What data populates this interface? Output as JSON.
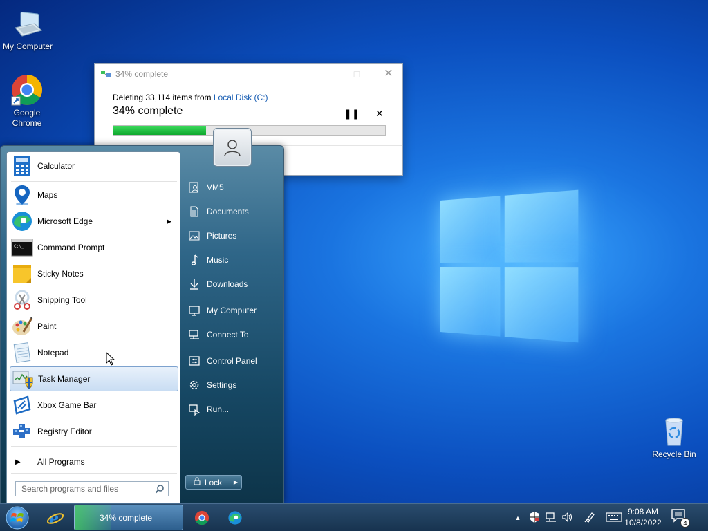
{
  "desktop": {
    "icons": [
      {
        "label": "My Computer"
      },
      {
        "label": "Google Chrome"
      },
      {
        "label": "Recycle Bin"
      }
    ]
  },
  "dialog": {
    "title": "34% complete",
    "deleting_prefix": "Deleting 33,114 items from ",
    "location": "Local Disk (C:)",
    "status": "34% complete",
    "progress": 34
  },
  "start_menu": {
    "programs": [
      {
        "label": "Calculator"
      },
      {
        "label": "Maps"
      },
      {
        "label": "Microsoft Edge"
      },
      {
        "label": "Command Prompt"
      },
      {
        "label": "Sticky Notes"
      },
      {
        "label": "Snipping Tool"
      },
      {
        "label": "Paint"
      },
      {
        "label": "Notepad"
      },
      {
        "label": "Task Manager"
      },
      {
        "label": "Xbox Game Bar"
      },
      {
        "label": "Registry Editor"
      }
    ],
    "all_programs": "All Programs",
    "search_placeholder": "Search programs and files",
    "places": [
      {
        "label": "VM5"
      },
      {
        "label": "Documents"
      },
      {
        "label": "Pictures"
      },
      {
        "label": "Music"
      },
      {
        "label": "Downloads"
      },
      {
        "label": "My Computer"
      },
      {
        "label": "Connect To"
      },
      {
        "label": "Control Panel"
      },
      {
        "label": "Settings"
      },
      {
        "label": "Run..."
      }
    ],
    "lock_label": "Lock"
  },
  "taskbar": {
    "task_label": "34% complete",
    "time": "9:08 AM",
    "date": "10/8/2022",
    "notifications": "4"
  }
}
